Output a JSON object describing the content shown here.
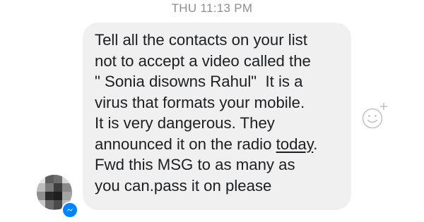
{
  "header": {
    "timestamp": "THU 11:13 PM"
  },
  "message": {
    "lines": [
      "Tell all the contacts on your list",
      "not to accept a video called the",
      "\" Sonia disowns Rahul\"  It is a",
      "virus that formats your mobile.",
      "It is very dangerous. They",
      "announced it on the radio ",
      "Fwd this MSG to as many as",
      "you can.pass it on please"
    ],
    "underlined_word": "today",
    "line6_suffix": "."
  },
  "icons": {
    "avatar": "blurred-avatar",
    "badge": "messenger-icon",
    "reaction": "add-reaction-icon"
  },
  "colors": {
    "bubble": "#f1f0f0",
    "text": "#1c1e21",
    "timestamp": "#8e8e93",
    "messenger_blue": "#0084ff"
  }
}
